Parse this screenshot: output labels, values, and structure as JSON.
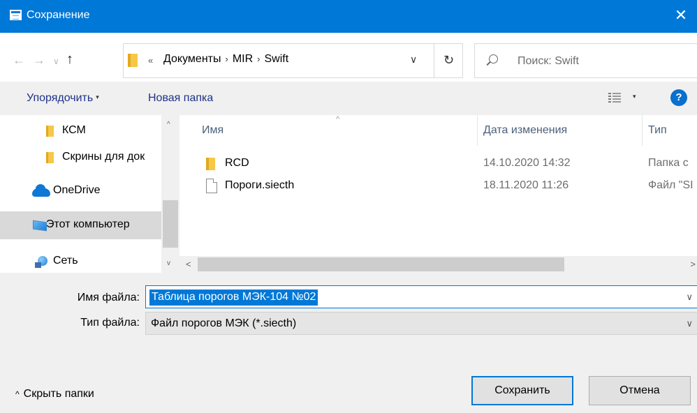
{
  "window": {
    "title": "Сохранение",
    "close_glyph": "✕"
  },
  "nav": {
    "back_glyph": "←",
    "forward_glyph": "→",
    "recent_glyph": "∨",
    "up_glyph": "↑",
    "breadcrumb_more": "«",
    "breadcrumbs": [
      "Документы",
      "MIR",
      "Swift"
    ],
    "separator": "›",
    "dropdown_glyph": "∨",
    "refresh_glyph": "↻",
    "search_placeholder": "Поиск: Swift"
  },
  "toolbar": {
    "organize_label": "Упорядочить",
    "organize_caret": "▾",
    "new_folder_label": "Новая папка",
    "view_caret": "▾",
    "help_glyph": "?"
  },
  "tree": {
    "items": [
      {
        "label": "КСМ",
        "icon": "folder-icon"
      },
      {
        "label": "Скрины для док",
        "icon": "folder-icon"
      },
      {
        "label": "OneDrive",
        "icon": "onedrive-icon"
      },
      {
        "label": "Этот компьютер",
        "icon": "computer-icon",
        "selected": true
      },
      {
        "label": "Сеть",
        "icon": "network-icon"
      }
    ],
    "scroll_up": "^",
    "scroll_down": "v"
  },
  "files": {
    "sort_glyph": "^",
    "columns": {
      "name": "Имя",
      "date": "Дата изменения",
      "type": "Тип"
    },
    "rows": [
      {
        "name": "RCD",
        "date": "14.10.2020 14:32",
        "type": "Папка с",
        "icon": "folder-icon"
      },
      {
        "name": "Пороги.siecth",
        "date": "18.11.2020 11:26",
        "type": "Файл \"SI",
        "icon": "file-icon"
      }
    ],
    "scroll_left": "<",
    "scroll_right": ">"
  },
  "form": {
    "filename_label": "Имя файла:",
    "filename_value": "Таблица порогов МЭК-104 №02",
    "filetype_label": "Тип файла:",
    "filetype_value": "Файл порогов МЭК (*.siecth)",
    "dropdown_glyph": "∨"
  },
  "footer": {
    "hide_folders_glyph": "^",
    "hide_folders_label": "Скрыть папки",
    "save_label": "Сохранить",
    "cancel_label": "Отмена"
  },
  "colors": {
    "accent": "#0078d7",
    "selected_tree": "#d9d9d9"
  }
}
